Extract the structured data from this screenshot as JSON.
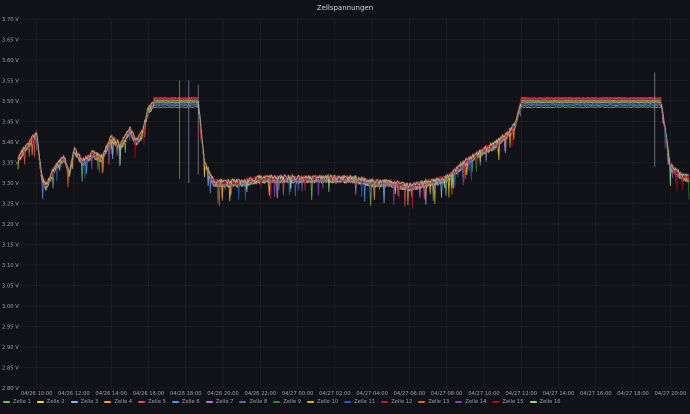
{
  "panel": {
    "title": "Zellspannungen"
  },
  "chart_data": {
    "type": "line",
    "title": "Zellspannungen",
    "xlabel": "",
    "ylabel": "",
    "ylim": [
      2.8,
      3.7
    ],
    "y_ticks": [
      "3.70 V",
      "3.65 V",
      "3.60 V",
      "3.55 V",
      "3.50 V",
      "3.45 V",
      "3.40 V",
      "3.35 V",
      "3.30 V",
      "3.25 V",
      "3.20 V",
      "3.15 V",
      "3.10 V",
      "3.05 V",
      "3.00 V",
      "2.95 V",
      "2.90 V",
      "2.85 V",
      "2.80 V"
    ],
    "x_ticks": [
      "04/26 10:00",
      "04/26 12:00",
      "04/26 14:00",
      "04/26 16:00",
      "04/26 18:00",
      "04/26 20:00",
      "04/26 22:00",
      "04/27 00:00",
      "04/27 02:00",
      "04/27 04:00",
      "04/27 06:00",
      "04/27 08:00",
      "04/27 10:00",
      "04/27 12:00",
      "04/27 14:00",
      "04/27 16:00",
      "04/27 18:00",
      "04/27 20:00"
    ],
    "x_range": [
      "04/26 09:00",
      "04/27 21:00"
    ],
    "grid": true,
    "legend_position": "bottom-left",
    "envelope": {
      "times": [
        "04/26 09:00",
        "04/26 09:30",
        "04/26 10:00",
        "04/26 10:15",
        "04/26 10:30",
        "04/26 11:00",
        "04/26 11:30",
        "04/26 11:45",
        "04/26 12:00",
        "04/26 12:30",
        "04/26 13:00",
        "04/26 13:30",
        "04/26 14:00",
        "04/26 14:30",
        "04/26 15:00",
        "04/26 15:20",
        "04/26 15:40",
        "04/26 16:00",
        "04/26 16:30",
        "04/26 17:00",
        "04/26 17:30",
        "04/26 18:00",
        "04/26 18:40",
        "04/26 19:00",
        "04/26 19:30",
        "04/26 20:00",
        "04/26 21:00",
        "04/26 22:00",
        "04/26 23:00",
        "04/27 00:00",
        "04/27 01:00",
        "04/27 02:00",
        "04/27 03:00",
        "04/27 04:00",
        "04/27 05:00",
        "04/27 06:00",
        "04/27 07:00",
        "04/27 08:00",
        "04/27 09:00",
        "04/27 10:00",
        "04/27 10:30",
        "04/27 11:00",
        "04/27 11:20",
        "04/27 11:40",
        "04/27 12:00",
        "04/27 13:00",
        "04/27 14:00",
        "04/27 15:00",
        "04/27 16:00",
        "04/27 17:00",
        "04/27 18:00",
        "04/27 19:00",
        "04/27 19:30",
        "04/27 20:00",
        "04/27 20:30",
        "04/27 21:00"
      ],
      "values": [
        3.36,
        3.39,
        3.42,
        3.32,
        3.29,
        3.34,
        3.36,
        3.32,
        3.38,
        3.35,
        3.37,
        3.36,
        3.41,
        3.39,
        3.43,
        3.4,
        3.42,
        3.48,
        3.5,
        3.5,
        3.5,
        3.5,
        3.5,
        3.35,
        3.3,
        3.3,
        3.3,
        3.31,
        3.31,
        3.31,
        3.31,
        3.31,
        3.31,
        3.3,
        3.3,
        3.29,
        3.3,
        3.31,
        3.35,
        3.38,
        3.39,
        3.41,
        3.42,
        3.44,
        3.5,
        3.5,
        3.5,
        3.5,
        3.5,
        3.5,
        3.5,
        3.5,
        3.5,
        3.34,
        3.32,
        3.31
      ]
    },
    "series": [
      {
        "name": "Zelle 1",
        "color": "#73bf69",
        "max_voltage": 3.505
      },
      {
        "name": "Zelle 2",
        "color": "#fade2a",
        "max_voltage": 3.5
      },
      {
        "name": "Zelle 3",
        "color": "#8ab8ff",
        "max_voltage": 3.49
      },
      {
        "name": "Zelle 4",
        "color": "#ff9830",
        "max_voltage": 3.502
      },
      {
        "name": "Zelle 5",
        "color": "#f2495c",
        "max_voltage": 3.508
      },
      {
        "name": "Zelle 6",
        "color": "#5794f2",
        "max_voltage": 3.495
      },
      {
        "name": "Zelle 7",
        "color": "#b877d9",
        "max_voltage": 3.506
      },
      {
        "name": "Zelle 8",
        "color": "#705da0",
        "max_voltage": 3.498
      },
      {
        "name": "Zelle 9",
        "color": "#37872d",
        "max_voltage": 3.5
      },
      {
        "name": "Zelle 10",
        "color": "#e0b400",
        "max_voltage": 3.497
      },
      {
        "name": "Zelle 11",
        "color": "#1f60c4",
        "max_voltage": 3.492
      },
      {
        "name": "Zelle 12",
        "color": "#c4162a",
        "max_voltage": 3.507
      },
      {
        "name": "Zelle 13",
        "color": "#fa6400",
        "max_voltage": 3.503
      },
      {
        "name": "Zelle 14",
        "color": "#8f3bb8",
        "max_voltage": 3.506
      },
      {
        "name": "Zelle 15",
        "color": "#ad0317",
        "max_voltage": 3.504
      },
      {
        "name": "Zelle 16",
        "color": "#96d98d",
        "max_voltage": 3.485
      }
    ]
  }
}
